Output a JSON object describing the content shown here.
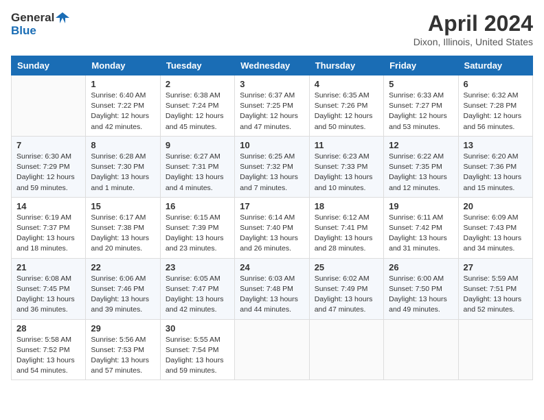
{
  "header": {
    "logo_line1": "General",
    "logo_line2": "Blue",
    "title": "April 2024",
    "subtitle": "Dixon, Illinois, United States"
  },
  "weekdays": [
    "Sunday",
    "Monday",
    "Tuesday",
    "Wednesday",
    "Thursday",
    "Friday",
    "Saturday"
  ],
  "weeks": [
    [
      {
        "day": "",
        "sunrise": "",
        "sunset": "",
        "daylight": ""
      },
      {
        "day": "1",
        "sunrise": "6:40 AM",
        "sunset": "7:22 PM",
        "daylight": "12 hours and 42 minutes."
      },
      {
        "day": "2",
        "sunrise": "6:38 AM",
        "sunset": "7:24 PM",
        "daylight": "12 hours and 45 minutes."
      },
      {
        "day": "3",
        "sunrise": "6:37 AM",
        "sunset": "7:25 PM",
        "daylight": "12 hours and 47 minutes."
      },
      {
        "day": "4",
        "sunrise": "6:35 AM",
        "sunset": "7:26 PM",
        "daylight": "12 hours and 50 minutes."
      },
      {
        "day": "5",
        "sunrise": "6:33 AM",
        "sunset": "7:27 PM",
        "daylight": "12 hours and 53 minutes."
      },
      {
        "day": "6",
        "sunrise": "6:32 AM",
        "sunset": "7:28 PM",
        "daylight": "12 hours and 56 minutes."
      }
    ],
    [
      {
        "day": "7",
        "sunrise": "6:30 AM",
        "sunset": "7:29 PM",
        "daylight": "12 hours and 59 minutes."
      },
      {
        "day": "8",
        "sunrise": "6:28 AM",
        "sunset": "7:30 PM",
        "daylight": "13 hours and 1 minute."
      },
      {
        "day": "9",
        "sunrise": "6:27 AM",
        "sunset": "7:31 PM",
        "daylight": "13 hours and 4 minutes."
      },
      {
        "day": "10",
        "sunrise": "6:25 AM",
        "sunset": "7:32 PM",
        "daylight": "13 hours and 7 minutes."
      },
      {
        "day": "11",
        "sunrise": "6:23 AM",
        "sunset": "7:33 PM",
        "daylight": "13 hours and 10 minutes."
      },
      {
        "day": "12",
        "sunrise": "6:22 AM",
        "sunset": "7:35 PM",
        "daylight": "13 hours and 12 minutes."
      },
      {
        "day": "13",
        "sunrise": "6:20 AM",
        "sunset": "7:36 PM",
        "daylight": "13 hours and 15 minutes."
      }
    ],
    [
      {
        "day": "14",
        "sunrise": "6:19 AM",
        "sunset": "7:37 PM",
        "daylight": "13 hours and 18 minutes."
      },
      {
        "day": "15",
        "sunrise": "6:17 AM",
        "sunset": "7:38 PM",
        "daylight": "13 hours and 20 minutes."
      },
      {
        "day": "16",
        "sunrise": "6:15 AM",
        "sunset": "7:39 PM",
        "daylight": "13 hours and 23 minutes."
      },
      {
        "day": "17",
        "sunrise": "6:14 AM",
        "sunset": "7:40 PM",
        "daylight": "13 hours and 26 minutes."
      },
      {
        "day": "18",
        "sunrise": "6:12 AM",
        "sunset": "7:41 PM",
        "daylight": "13 hours and 28 minutes."
      },
      {
        "day": "19",
        "sunrise": "6:11 AM",
        "sunset": "7:42 PM",
        "daylight": "13 hours and 31 minutes."
      },
      {
        "day": "20",
        "sunrise": "6:09 AM",
        "sunset": "7:43 PM",
        "daylight": "13 hours and 34 minutes."
      }
    ],
    [
      {
        "day": "21",
        "sunrise": "6:08 AM",
        "sunset": "7:45 PM",
        "daylight": "13 hours and 36 minutes."
      },
      {
        "day": "22",
        "sunrise": "6:06 AM",
        "sunset": "7:46 PM",
        "daylight": "13 hours and 39 minutes."
      },
      {
        "day": "23",
        "sunrise": "6:05 AM",
        "sunset": "7:47 PM",
        "daylight": "13 hours and 42 minutes."
      },
      {
        "day": "24",
        "sunrise": "6:03 AM",
        "sunset": "7:48 PM",
        "daylight": "13 hours and 44 minutes."
      },
      {
        "day": "25",
        "sunrise": "6:02 AM",
        "sunset": "7:49 PM",
        "daylight": "13 hours and 47 minutes."
      },
      {
        "day": "26",
        "sunrise": "6:00 AM",
        "sunset": "7:50 PM",
        "daylight": "13 hours and 49 minutes."
      },
      {
        "day": "27",
        "sunrise": "5:59 AM",
        "sunset": "7:51 PM",
        "daylight": "13 hours and 52 minutes."
      }
    ],
    [
      {
        "day": "28",
        "sunrise": "5:58 AM",
        "sunset": "7:52 PM",
        "daylight": "13 hours and 54 minutes."
      },
      {
        "day": "29",
        "sunrise": "5:56 AM",
        "sunset": "7:53 PM",
        "daylight": "13 hours and 57 minutes."
      },
      {
        "day": "30",
        "sunrise": "5:55 AM",
        "sunset": "7:54 PM",
        "daylight": "13 hours and 59 minutes."
      },
      {
        "day": "",
        "sunrise": "",
        "sunset": "",
        "daylight": ""
      },
      {
        "day": "",
        "sunrise": "",
        "sunset": "",
        "daylight": ""
      },
      {
        "day": "",
        "sunrise": "",
        "sunset": "",
        "daylight": ""
      },
      {
        "day": "",
        "sunrise": "",
        "sunset": "",
        "daylight": ""
      }
    ]
  ]
}
